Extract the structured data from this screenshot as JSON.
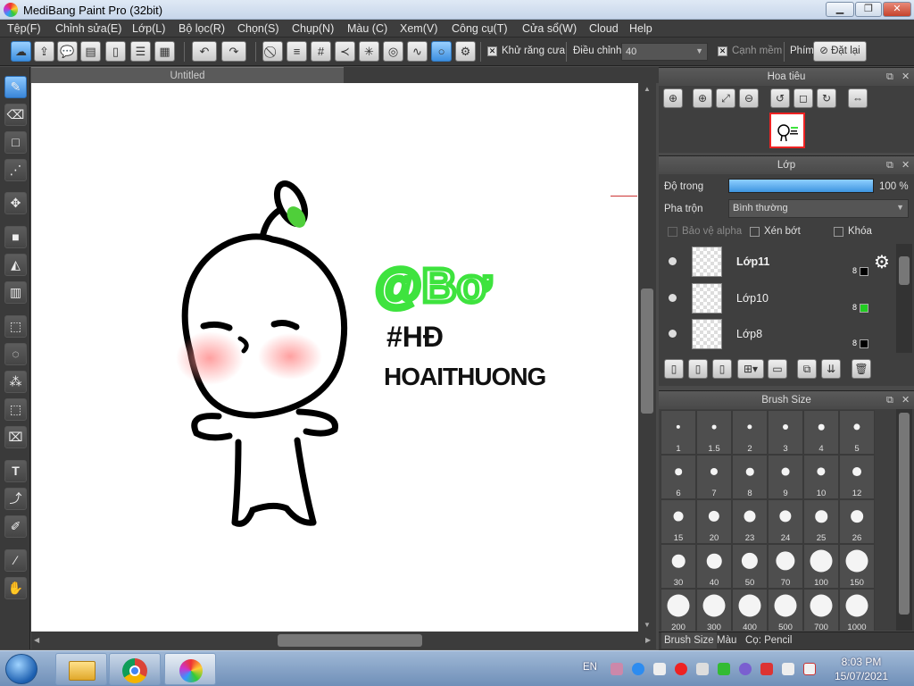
{
  "window": {
    "title": "MediBang Paint Pro (32bit)"
  },
  "menu": [
    "Tệp(F)",
    "Chỉnh sửa(E)",
    "Lớp(L)",
    "Bộ lọc(R)",
    "Chọn(S)",
    "Chụp(N)",
    "Màu (C)",
    "Xem(V)",
    "Công cụ(T)",
    "Cửa sổ(W)",
    "Cloud",
    "Help"
  ],
  "toolbar": {
    "antialias_label": "Khử răng cưa",
    "correction_label": "Điều chỉnh",
    "correction_value": "40",
    "smooth_edge_label": "Cạnh mềm",
    "keys_label": "Phím",
    "reset_label": "Đặt lại"
  },
  "document": {
    "tab_title": "Untitled"
  },
  "canvas_art": {
    "line1": "@Bơ",
    "line2": "#HĐ",
    "line3": "HOAITHUONG"
  },
  "navigator": {
    "title": "Hoa tiêu"
  },
  "layer_panel": {
    "title": "Lớp",
    "opacity_label": "Độ trong",
    "opacity_value": "100 %",
    "opacity_fraction": 1.0,
    "blend_label": "Pha trộn",
    "blend_value": "Bình thường",
    "protect_alpha": "Bảo vệ alpha",
    "clipping": "Xén bớt",
    "lock": "Khóa",
    "layers": [
      {
        "name": "Lớp11",
        "bits": "8",
        "color": "#000000",
        "selected": true
      },
      {
        "name": "Lớp10",
        "bits": "8",
        "color": "#22cc22",
        "selected": false
      },
      {
        "name": "Lớp8",
        "bits": "8",
        "color": "#000000",
        "selected": false
      }
    ]
  },
  "brush_panel": {
    "title": "Brush Size",
    "sizes": [
      "1",
      "1.5",
      "2",
      "3",
      "4",
      "5",
      "6",
      "7",
      "8",
      "9",
      "10",
      "12",
      "15",
      "20",
      "23",
      "24",
      "25",
      "26",
      "30",
      "40",
      "50",
      "70",
      "100",
      "150",
      "200",
      "300",
      "400",
      "500",
      "700",
      "1000"
    ],
    "tabs": [
      "Brush Size",
      "Màu",
      "Cọ: Pencil"
    ]
  },
  "taskbar": {
    "lang": "EN",
    "time": "8:03 PM",
    "date": "15/07/2021"
  },
  "colors": {
    "accent": "#4a9de0",
    "panel": "#3f3f3f",
    "selected_layer": "#4a9de0"
  }
}
